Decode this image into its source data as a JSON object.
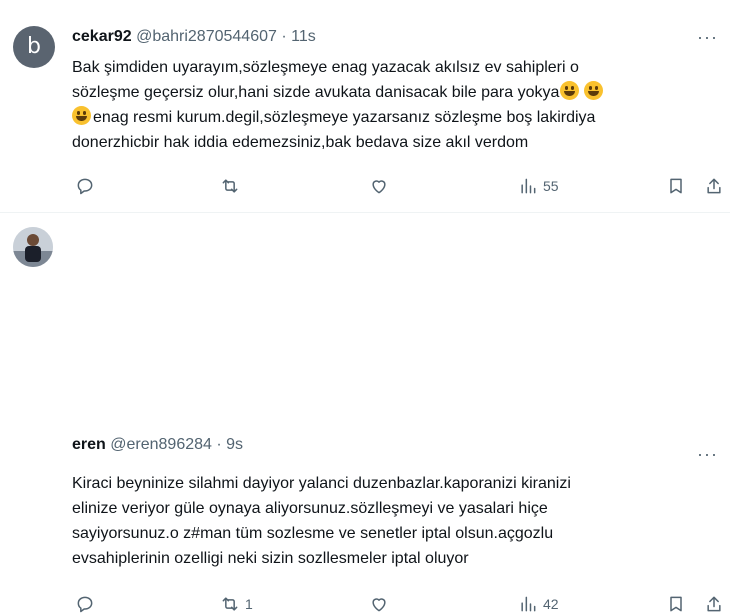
{
  "tweets": [
    {
      "avatar_letter": "b",
      "name": "cekar92",
      "handle": "@bahri2870544607",
      "separator": "·",
      "time": "11s",
      "more": "···",
      "lines": [
        "Bak şimdiden uyarayım,sözleşmeye enag yazacak akılsız ev sahipleri o",
        "sözleşme geçersiz olur,hani sizde avukata danisacak bile para yokya",
        "enag resmi kurum.degil,sözleşmeye yazarsanız sözleşme boş lakirdiya",
        "donerzhicbir hak iddia edemezsiniz,bak bedava size akıl verdom"
      ],
      "reply_count": "",
      "retweet_count": "",
      "like_count": "",
      "views_count": "55"
    },
    {
      "name": "eren",
      "handle": "@eren896284",
      "separator": "·",
      "time": "9s",
      "more": "···",
      "lines": [
        "Kiraci beyninize silahmi dayiyor yalanci duzenbazlar.kaporanizi kiranizi",
        "elinize veriyor güle oynaya aliyorsunuz.sözlleşmeyi ve yasalari hiçe",
        "sayiyorsunuz.o z#man tüm sozlesme ve senetler iptal olsun.açgozlu",
        "evsahiplerinin ozelligi neki sizin sozllesmeler iptal oluyor"
      ],
      "reply_count": "",
      "retweet_count": "1",
      "like_count": "",
      "views_count": "42"
    }
  ],
  "icons": [
    "reply-icon",
    "retweet-icon",
    "like-icon",
    "views-icon",
    "bookmark-icon",
    "share-icon",
    "more-icon",
    "smiley-emoji"
  ]
}
